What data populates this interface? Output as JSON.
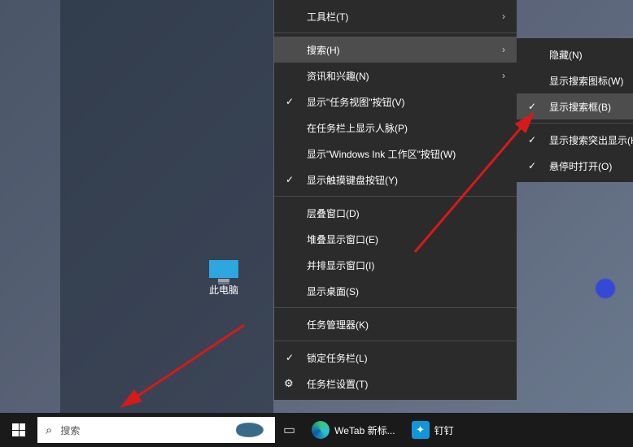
{
  "desktop": {
    "this_pc_label": "此电脑"
  },
  "context_menu": {
    "items": [
      {
        "label": "工具栏(T)",
        "hasSubmenu": true
      },
      {
        "label": "搜索(H)",
        "hasSubmenu": true,
        "highlighted": true
      },
      {
        "label": "资讯和兴趣(N)",
        "hasSubmenu": true
      },
      {
        "label": "显示\"任务视图\"按钮(V)",
        "checked": true
      },
      {
        "label": "在任务栏上显示人脉(P)"
      },
      {
        "label": "显示\"Windows Ink 工作区\"按钮(W)"
      },
      {
        "label": "显示触摸键盘按钮(Y)",
        "checked": true
      },
      {
        "label": "层叠窗口(D)"
      },
      {
        "label": "堆叠显示窗口(E)"
      },
      {
        "label": "并排显示窗口(I)"
      },
      {
        "label": "显示桌面(S)"
      },
      {
        "label": "任务管理器(K)"
      },
      {
        "label": "锁定任务栏(L)",
        "checked": true
      },
      {
        "label": "任务栏设置(T)",
        "gear": true
      }
    ]
  },
  "search_submenu": {
    "items": [
      {
        "label": "隐藏(N)"
      },
      {
        "label": "显示搜索图标(W)"
      },
      {
        "label": "显示搜索框(B)",
        "checked": true,
        "highlighted": true
      },
      {
        "label": "显示搜索突出显示(H)",
        "checked": true
      },
      {
        "label": "悬停时打开(O)",
        "checked": true
      }
    ]
  },
  "taskbar": {
    "search_placeholder": "搜索",
    "apps": [
      {
        "name": "task-view",
        "label": ""
      },
      {
        "name": "edge",
        "label": "WeTab 新标..."
      },
      {
        "name": "dingtalk",
        "label": "钉钉"
      }
    ]
  },
  "colors": {
    "menu_bg": "#2b2b2b",
    "menu_hover": "#4d4d4d",
    "taskbar_bg": "#1a1a1a",
    "accent_blue": "#0078d4",
    "dingtalk_blue": "#1296db",
    "annotation_red": "#d61a1a"
  }
}
